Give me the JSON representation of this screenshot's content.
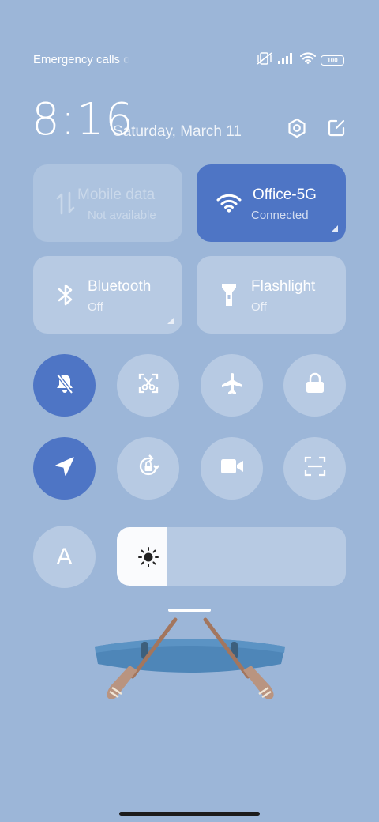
{
  "status_bar": {
    "carrier_text": "Emergency calls only",
    "battery": "100",
    "icons": [
      "vibrate-off-icon",
      "signal-icon",
      "wifi-icon",
      "battery-icon"
    ]
  },
  "header": {
    "time": "8:16",
    "date": "Saturday, March 11",
    "icons": [
      "settings-icon",
      "edit-icon"
    ]
  },
  "tiles": {
    "mobile_data": {
      "title": "Mobile data",
      "subtitle": "Not available",
      "state": "disabled",
      "icon": "mobile-data-icon"
    },
    "wifi": {
      "title": "Office-5G",
      "subtitle": "Connected",
      "state": "on",
      "icon": "wifi-icon"
    },
    "bluetooth": {
      "title": "Bluetooth",
      "subtitle": "Off",
      "state": "off",
      "icon": "bluetooth-icon"
    },
    "flashlight": {
      "title": "Flashlight",
      "subtitle": "Off",
      "state": "off",
      "icon": "flashlight-icon"
    }
  },
  "toggles": [
    {
      "name": "silent-mode",
      "icon": "bell-off-icon",
      "on": true
    },
    {
      "name": "screenshot",
      "icon": "scissors-icon",
      "on": false
    },
    {
      "name": "airplane-mode",
      "icon": "airplane-icon",
      "on": false
    },
    {
      "name": "lock-screen",
      "icon": "lock-icon",
      "on": false
    },
    {
      "name": "location",
      "icon": "location-arrow-icon",
      "on": true
    },
    {
      "name": "rotation-lock",
      "icon": "rotate-lock-icon",
      "on": false
    },
    {
      "name": "screen-recorder",
      "icon": "video-camera-icon",
      "on": false
    },
    {
      "name": "scanner",
      "icon": "scan-icon",
      "on": false
    }
  ],
  "brightness": {
    "auto_label": "A",
    "level": 0.22
  },
  "colors": {
    "background": "#9cb6d8",
    "accent": "#4e75c5",
    "tile": "rgba(255,255,255,0.28)"
  }
}
